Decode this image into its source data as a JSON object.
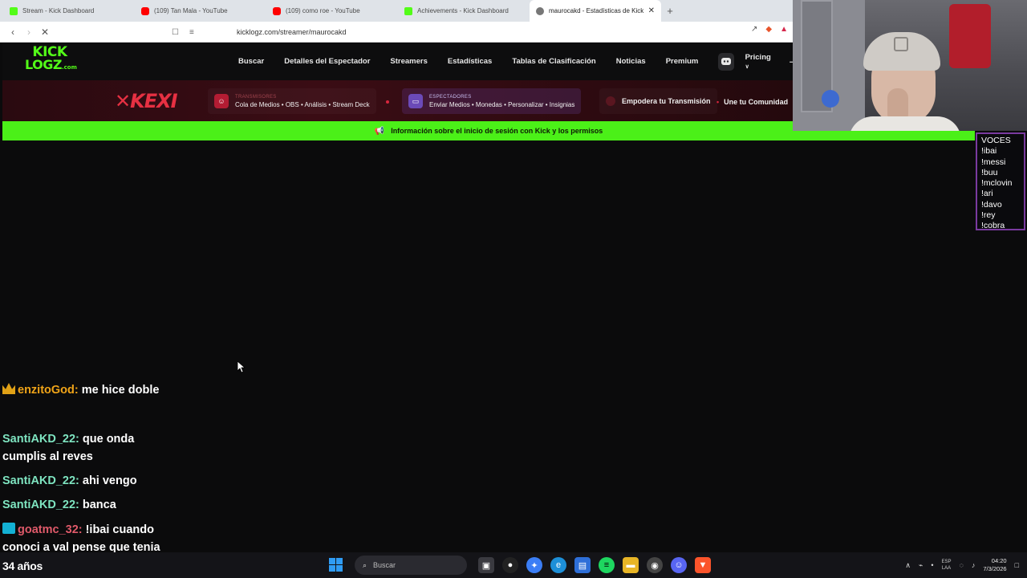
{
  "browser": {
    "tabs": [
      {
        "label": "Stream - Kick Dashboard",
        "favicon": "kick-favicon"
      },
      {
        "label": "(109) Tan Mala - YouTube",
        "favicon": "youtube-favicon"
      },
      {
        "label": "(109) como roe - YouTube",
        "favicon": "youtube-favicon"
      },
      {
        "label": "Achievements - Kick Dashboard",
        "favicon": "kick-favicon"
      },
      {
        "label": "maurocakd - Estadísticas de Kick",
        "favicon": "kicklogz-favicon",
        "active": true
      }
    ],
    "new_tab": "+",
    "close_tab": "✕",
    "url": "kicklogz.com/streamer/maurocakd"
  },
  "site": {
    "logo_line1": "KICK",
    "logo_line2": "LOGZ",
    "logo_suffix": ".com",
    "nav": [
      "Buscar",
      "Detalles del Espectador",
      "Streamers",
      "Estadísticas",
      "Tablas de Clasificación",
      "Noticias",
      "Premium"
    ],
    "pricing": "Pricing",
    "accent": "#53fc18"
  },
  "promo": {
    "brand": "KEXI",
    "chip1_small": "TRANSMISORES",
    "chip1_big": "Cola de Medios • OBS • Análisis • Stream Deck",
    "chip2_small": "ESPECTADORES",
    "chip2_big": "Enviar Medios • Monedas • Personalizar • Insignias",
    "chip3_big": "Empodera tu Transmisión",
    "tail": "Une tu Comunidad"
  },
  "notice": {
    "text": "Información sobre el inicio de sesión con Kick y los permisos"
  },
  "voices": {
    "lines": [
      "VOCES",
      "!ibai",
      "!messi",
      "!buu",
      "!mclovin",
      "!ari",
      "!davo",
      "!rey",
      "!cobra"
    ]
  },
  "chat": {
    "messages": [
      {
        "user": "enzitoGod:",
        "text": "me hice doble",
        "badge": "crown"
      },
      {
        "user": "SantiAKD_22:",
        "text": "que onda cumplis al reves"
      },
      {
        "user": "SantiAKD_22:",
        "text": "ahi vengo"
      },
      {
        "user": "SantiAKD_22:",
        "text": "banca"
      },
      {
        "user": "goatmc_32:",
        "text": "!ibai cuando conoci a val pense que tenia",
        "badge": "sub"
      }
    ]
  },
  "overlay": {
    "age_label": "34 años"
  },
  "taskbar": {
    "search_placeholder": "Buscar",
    "lang_line1": "ESP",
    "lang_line2": "LAA",
    "time": "04:20",
    "date": "7/3/2026"
  }
}
